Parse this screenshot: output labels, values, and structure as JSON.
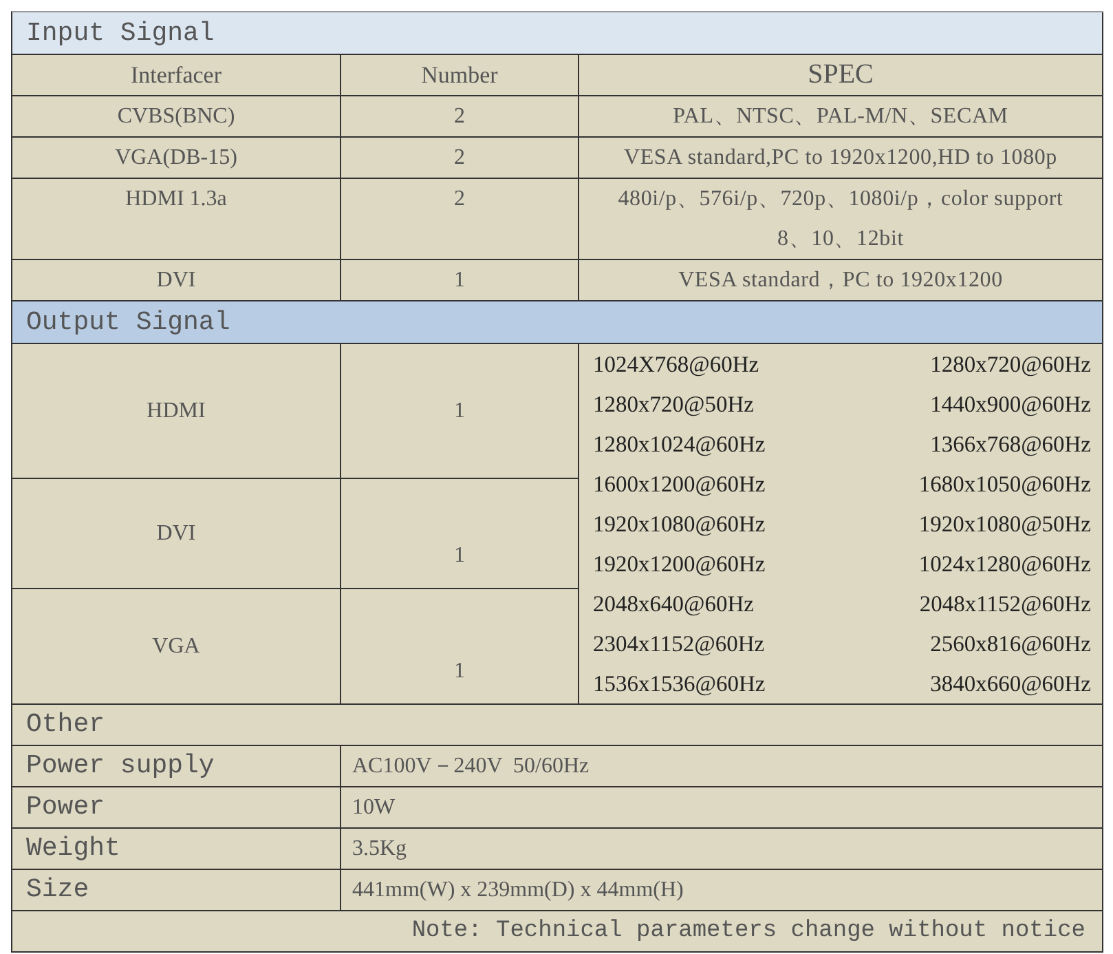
{
  "input_signal": {
    "title": "Input Signal",
    "columns": [
      "Interfacer",
      "Number",
      "SPEC"
    ],
    "rows": [
      {
        "interface": "CVBS(BNC)",
        "number": "2",
        "spec": "PAL、NTSC、PAL-M/N、SECAM"
      },
      {
        "interface": "VGA(DB-15)",
        "number": "2",
        "spec": "VESA standard,PC to 1920x1200,HD to 1080p"
      },
      {
        "interface": "HDMI 1.3a",
        "number": "2",
        "spec": "480i/p、576i/p、720p、1080i/p，color support 8、10、12bit"
      },
      {
        "interface": "DVI",
        "number": "1",
        "spec": "VESA standard，PC to 1920x1200"
      }
    ]
  },
  "output_signal": {
    "title": "Output Signal",
    "rows": [
      {
        "interface": "HDMI",
        "number": "1"
      },
      {
        "interface": "DVI",
        "number": "1"
      },
      {
        "interface": "VGA",
        "number": "1"
      }
    ],
    "resolutions": [
      [
        "1024X768@60Hz",
        "1280x720@60Hz"
      ],
      [
        "1280x720@50Hz",
        "1440x900@60Hz"
      ],
      [
        "1280x1024@60Hz",
        "1366x768@60Hz"
      ],
      [
        "1600x1200@60Hz",
        "1680x1050@60Hz"
      ],
      [
        "1920x1080@60Hz",
        "1920x1080@50Hz"
      ],
      [
        "1920x1200@60Hz",
        "1024x1280@60Hz"
      ],
      [
        "2048x640@60Hz",
        "2048x1152@60Hz"
      ],
      [
        "2304x1152@60Hz",
        "2560x816@60Hz"
      ],
      [
        "1536x1536@60Hz",
        "3840x660@60Hz"
      ]
    ]
  },
  "other": {
    "title": "Other",
    "rows": [
      {
        "label": "Power supply",
        "value": "AC100V－240V  50/60Hz"
      },
      {
        "label": "Power",
        "value": "10W"
      },
      {
        "label": "Weight",
        "value": "3.5Kg"
      },
      {
        "label": "Size",
        "value": "441mm(W) x 239mm(D) x 44mm(H)"
      }
    ]
  },
  "note": "Note: Technical parameters change without notice"
}
